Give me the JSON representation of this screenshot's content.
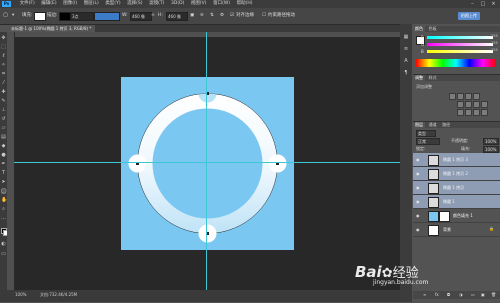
{
  "app": {
    "logo": "Ps",
    "menus": [
      "文件(F)",
      "编辑(E)",
      "图像(I)",
      "图层(L)",
      "类型(Y)",
      "选择(S)",
      "滤镜(T)",
      "3D(D)",
      "视图(V)",
      "窗口(W)",
      "帮助(H)"
    ],
    "window_controls": [
      "–",
      "□",
      "×"
    ]
  },
  "options": {
    "fill_label": "填充:",
    "stroke_label": "描边:",
    "stroke_size": "3点",
    "w_label": "W:",
    "w_value": "460 像",
    "h_label": "H:",
    "h_value": "460 像",
    "align_edges": "对齐边缘",
    "constrain_label": "约束路径拖动",
    "upload_badge": "拍照上传"
  },
  "document": {
    "tab": "未标题-1 @ 100%(椭圆 1 拷贝 3, RGB/8) *",
    "canvas_color": "#7ac8f1"
  },
  "status": {
    "zoom": "100%",
    "doc_info": "文档:732.4K/4.25M"
  },
  "color_panel": {
    "tabs": [
      "颜色",
      "色板"
    ],
    "slider_labels": [
      "R",
      "G",
      "B"
    ],
    "values": [
      "255",
      "255",
      "255"
    ]
  },
  "adjust_panel": {
    "tabs": [
      "调整",
      "样式"
    ],
    "title": "添加调整"
  },
  "layers_panel": {
    "tabs": [
      "图层",
      "通道",
      "路径"
    ],
    "kind_label": "类型",
    "blend_mode": "正常",
    "opacity_label": "不透明度:",
    "opacity_value": "100%",
    "lock_label": "锁定:",
    "fill_label": "填充:",
    "fill_value": "100%",
    "layers": [
      {
        "name": "椭圆 1 拷贝 3",
        "selected": true
      },
      {
        "name": "椭圆 1 拷贝 2",
        "selected": true
      },
      {
        "name": "椭圆 1 拷贝",
        "selected": true
      },
      {
        "name": "椭圆 1",
        "selected": true
      },
      {
        "name": "颜色填充 1",
        "selected": false
      },
      {
        "name": "背景",
        "selected": false
      }
    ]
  },
  "watermark": {
    "brand": "Bai",
    "brand_cn": "经验",
    "domain": "jingyan.baidu.com"
  }
}
